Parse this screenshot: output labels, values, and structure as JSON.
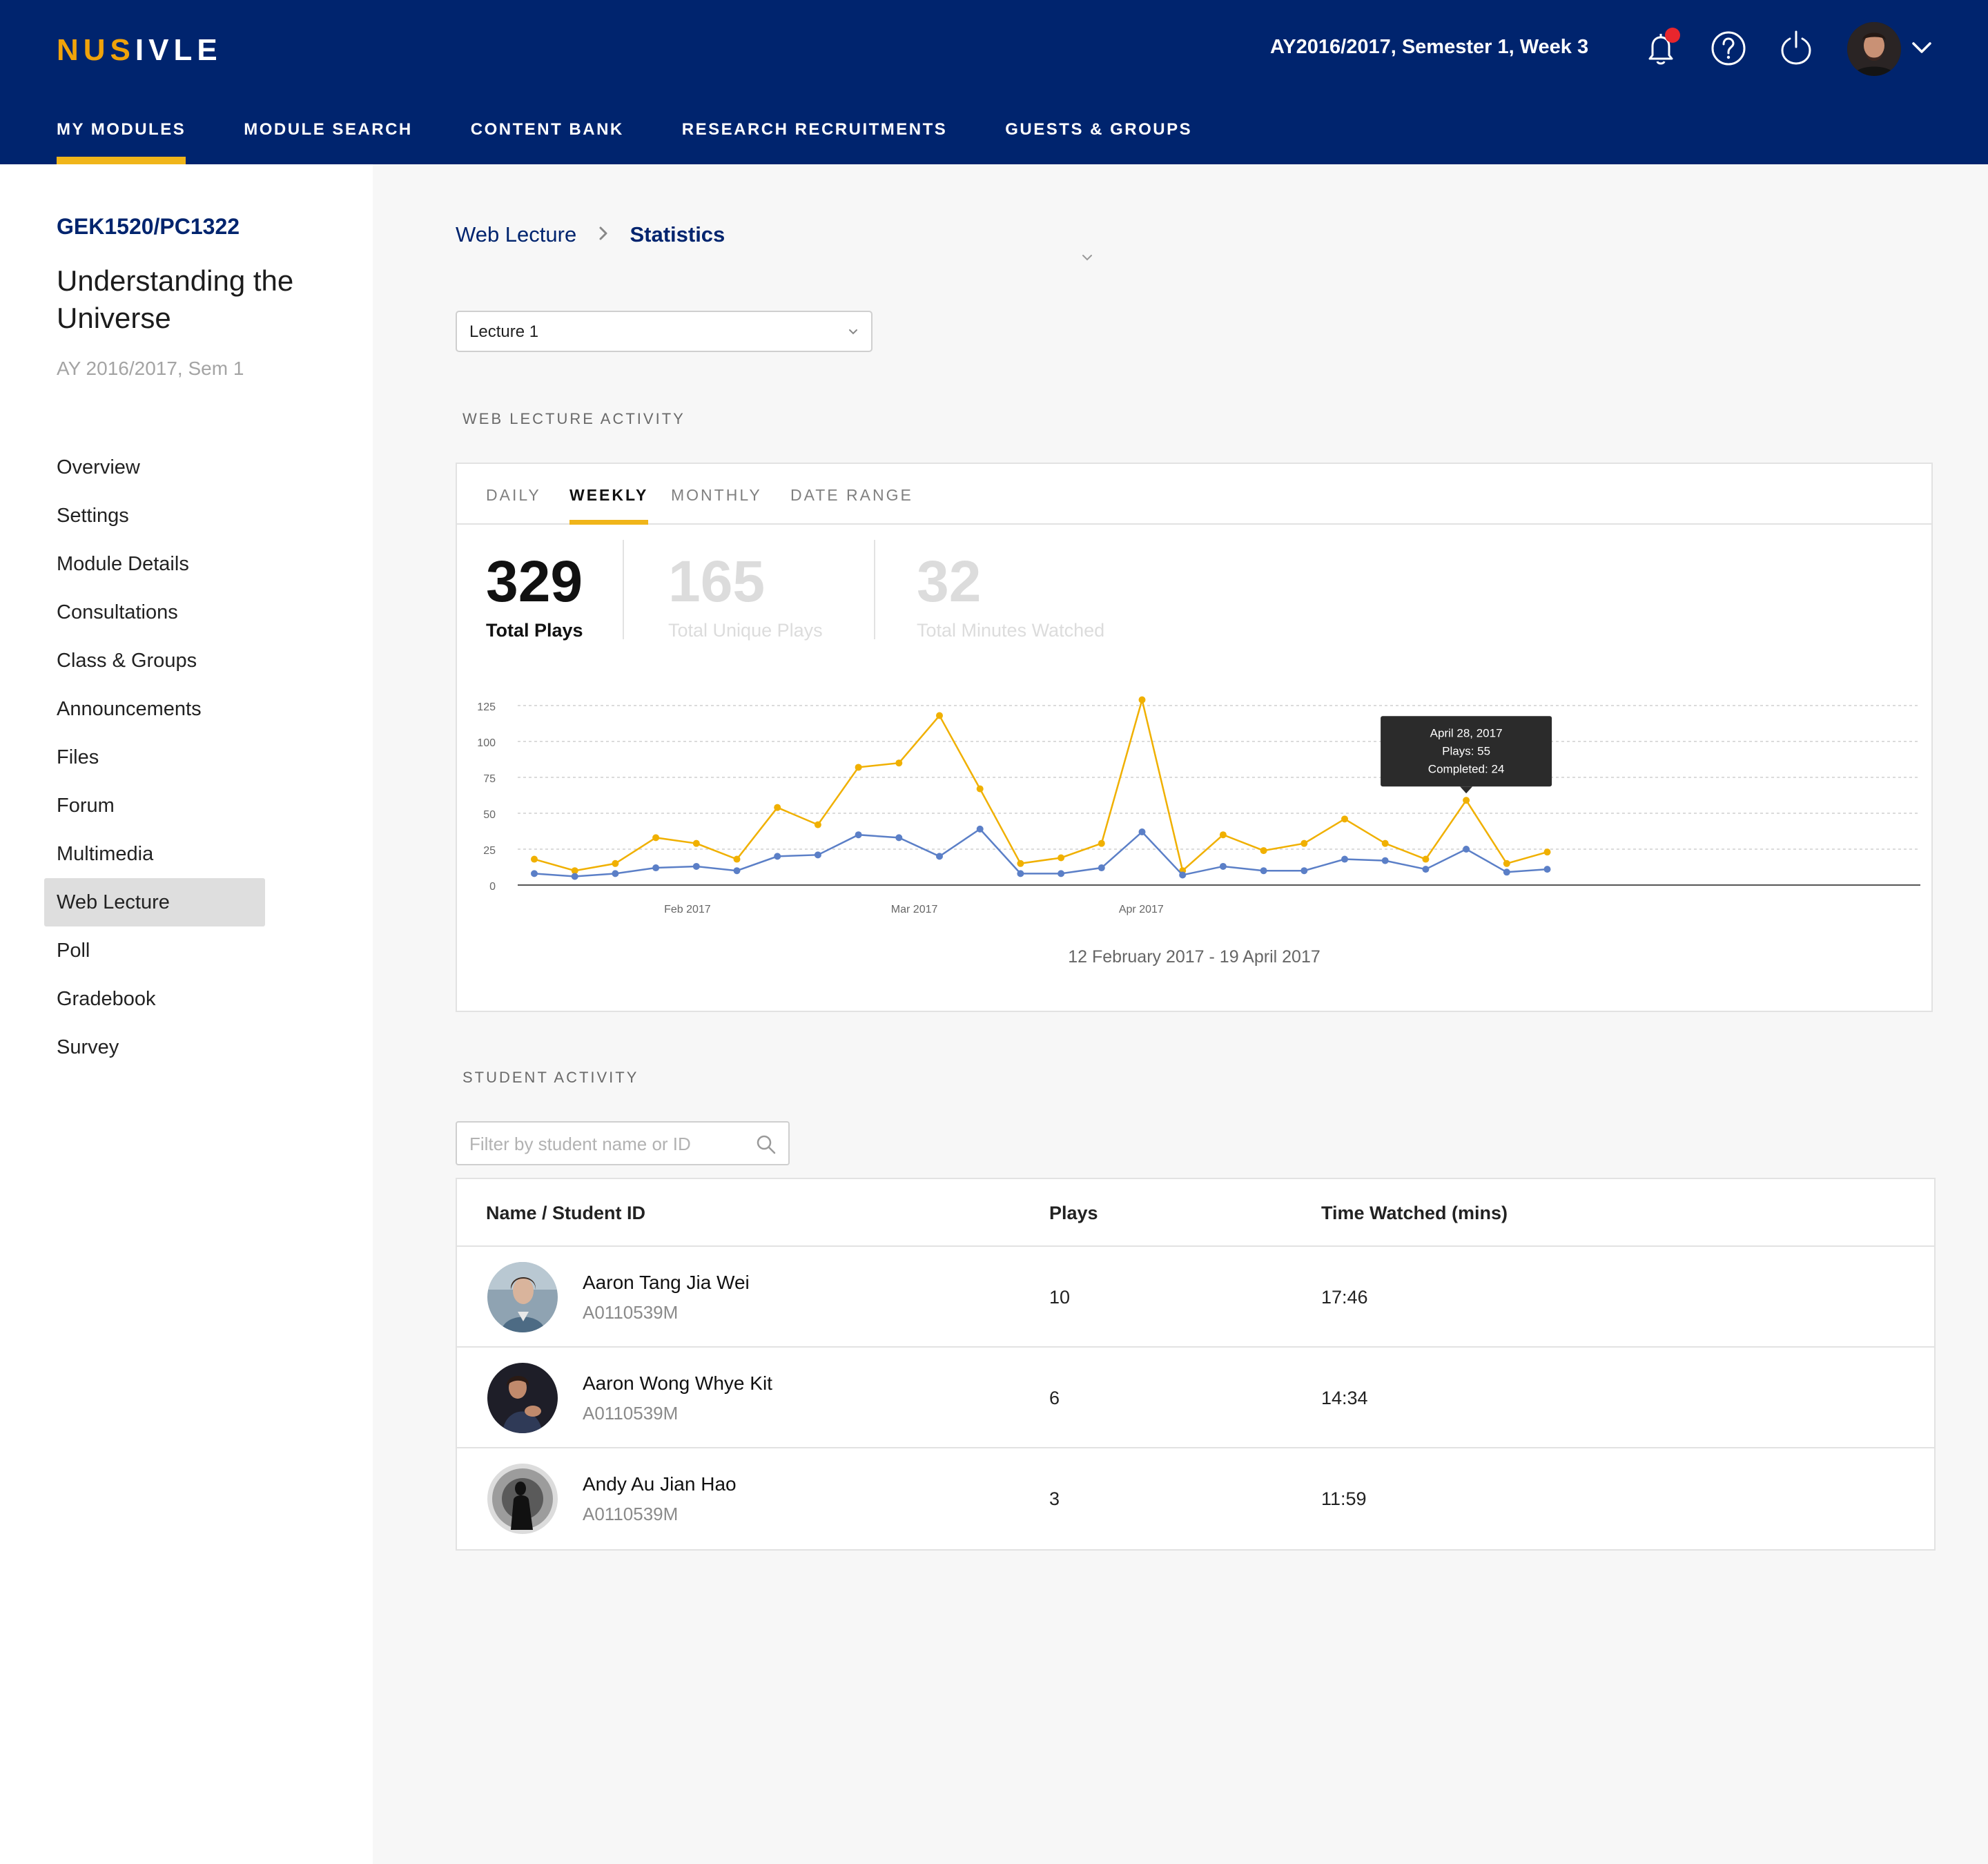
{
  "header": {
    "logo_a": "NUS",
    "logo_b": "IVLE",
    "term": "AY2016/2017, Semester 1, Week 3",
    "nav": [
      "MY MODULES",
      "MODULE SEARCH",
      "CONTENT BANK",
      "RESEARCH RECRUITMENTS",
      "GUESTS & GROUPS"
    ],
    "active_nav": "MY MODULES",
    "icons": [
      "bell-icon",
      "help-icon",
      "power-icon",
      "chevron-down-icon"
    ],
    "has_notification": true
  },
  "sidebar": {
    "module_code": "GEK1520/PC1322",
    "module_title": "Understanding the Universe",
    "semester": "AY 2016/2017, Sem 1",
    "items": [
      "Overview",
      "Settings",
      "Module Details",
      "Consultations",
      "Class & Groups",
      "Announcements",
      "Files",
      "Forum",
      "Multimedia",
      "Web Lecture",
      "Poll",
      "Gradebook",
      "Survey"
    ],
    "active_item": "Web Lecture"
  },
  "breadcrumb": {
    "parent": "Web Lecture",
    "current": "Statistics"
  },
  "lecture_select": {
    "value": "Lecture 1"
  },
  "activity": {
    "section_title": "WEB LECTURE ACTIVITY",
    "tabs": [
      "DAILY",
      "WEEKLY",
      "MONTHLY",
      "DATE RANGE"
    ],
    "active_tab": "WEEKLY",
    "stats": [
      {
        "value": "329",
        "label": "Total Plays"
      },
      {
        "value": "165",
        "label": "Total Unique Plays"
      },
      {
        "value": "32",
        "label": "Total Minutes Watched"
      }
    ],
    "range_caption": "12 February 2017 - 19 April 2017",
    "tooltip": {
      "line1": "April 28, 2017",
      "line2": "Plays: 55",
      "line3": "Completed: 24"
    }
  },
  "chart_data": {
    "type": "line",
    "ylim": [
      0,
      125
    ],
    "yticks": [
      "125",
      "100",
      "75",
      "50",
      "25",
      "0"
    ],
    "xtick_labels": [
      "Feb 2017",
      "Mar 2017",
      "Apr 2017"
    ],
    "grid": true,
    "colors": {
      "plays": "#f0b000",
      "completed": "#5b7fc7"
    },
    "series": [
      {
        "values": [
          18,
          10,
          15,
          33,
          29,
          18,
          54,
          42,
          82,
          85,
          118,
          67,
          15,
          19,
          29,
          129,
          10,
          35,
          24,
          29,
          46,
          29,
          18,
          59,
          15,
          23
        ]
      },
      {
        "values": [
          8,
          6,
          8,
          12,
          13,
          10,
          20,
          21,
          35,
          33,
          20,
          39,
          8,
          8,
          12,
          37,
          7,
          13,
          10,
          10,
          18,
          17,
          11,
          25,
          9,
          11
        ]
      }
    ]
  },
  "students": {
    "section_title": "STUDENT ACTIVITY",
    "filter_placeholder": "Filter by student name or ID",
    "columns": [
      "Name / Student ID",
      "Plays",
      "Time Watched (mins)"
    ],
    "rows": [
      {
        "name": "Aaron Tang Jia Wei",
        "id": "A0110539M",
        "plays": "10",
        "time": "17:46"
      },
      {
        "name": "Aaron Wong Whye Kit",
        "id": "A0110539M",
        "plays": "6",
        "time": "14:34"
      },
      {
        "name": "Andy Au Jian Hao",
        "id": "A0110539M",
        "plays": "3",
        "time": "11:59"
      }
    ]
  }
}
